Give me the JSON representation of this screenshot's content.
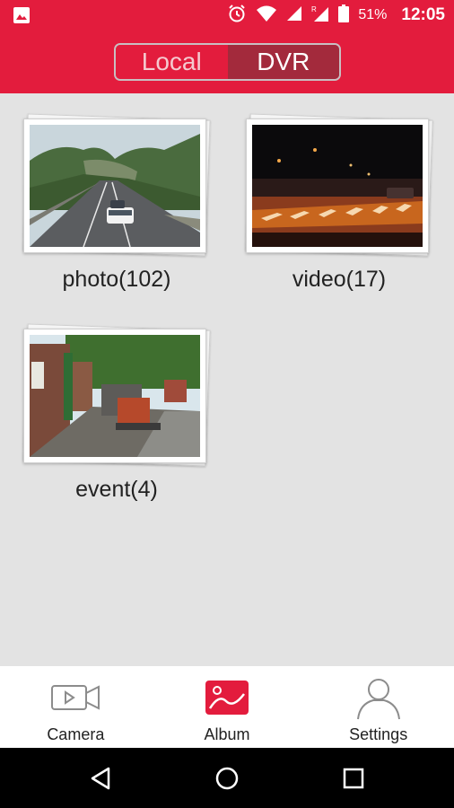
{
  "status_bar": {
    "battery_percent": "51%",
    "time": "12:05",
    "icons": [
      "image-notification-icon",
      "alarm-icon",
      "wifi-icon",
      "signal-icon",
      "roaming-signal-icon",
      "battery-icon"
    ]
  },
  "header": {
    "segments": [
      {
        "label": "Local",
        "selected": false
      },
      {
        "label": "DVR",
        "selected": true
      }
    ],
    "accent_color": "#e31c3d"
  },
  "albums": [
    {
      "label": "photo(102)",
      "thumbnail": "highway-road-photo"
    },
    {
      "label": "video(17)",
      "thumbnail": "night-road-video-frame"
    },
    {
      "label": "event(4)",
      "thumbnail": "street-truck-photo"
    }
  ],
  "bottom_nav": {
    "items": [
      {
        "label": "Camera",
        "icon": "video-camera-icon",
        "active": false
      },
      {
        "label": "Album",
        "icon": "album-image-icon",
        "active": true
      },
      {
        "label": "Settings",
        "icon": "user-profile-icon",
        "active": false
      }
    ]
  },
  "system_nav": [
    "back-icon",
    "home-icon",
    "recents-icon"
  ]
}
